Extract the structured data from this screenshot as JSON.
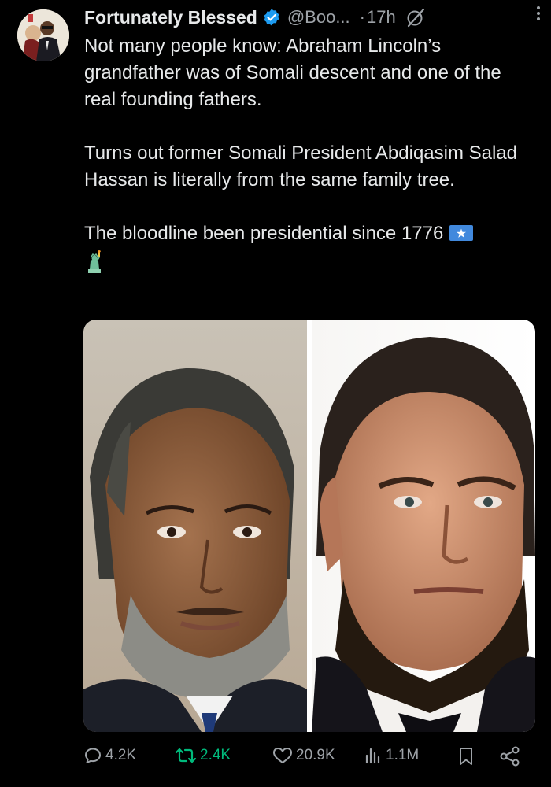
{
  "tweet": {
    "author": {
      "display_name": "Fortunately Blessed",
      "handle": "@Boo...",
      "verified": true,
      "avatar_icon": "avatar-photo"
    },
    "separator": "·",
    "time": "17h",
    "paragraphs": [
      "Not many people know: Abraham Lincoln’s grandfather was of Somali descent and one of the real founding fathers.",
      "Turns out former Somali President Abdiqasim Salad Hassan is literally from the same family tree.",
      "The bloodline been presidential since 1776"
    ],
    "paragraph_emojis": [
      "somalia-flag-emoji",
      "statue-of-liberty-emoji"
    ],
    "media": {
      "type": "image",
      "description_icons": [
        "portrait-left",
        "portrait-right"
      ]
    },
    "actions": {
      "replies": "4.2K",
      "reposts": "2.4K",
      "likes": "20.9K",
      "views": "1.1M"
    }
  },
  "colors": {
    "background": "#000000",
    "text": "#e7e9ea",
    "secondary": "#9ea3a8",
    "verified_blue": "#1d9bf0",
    "repost_green": "#00ba7c"
  }
}
